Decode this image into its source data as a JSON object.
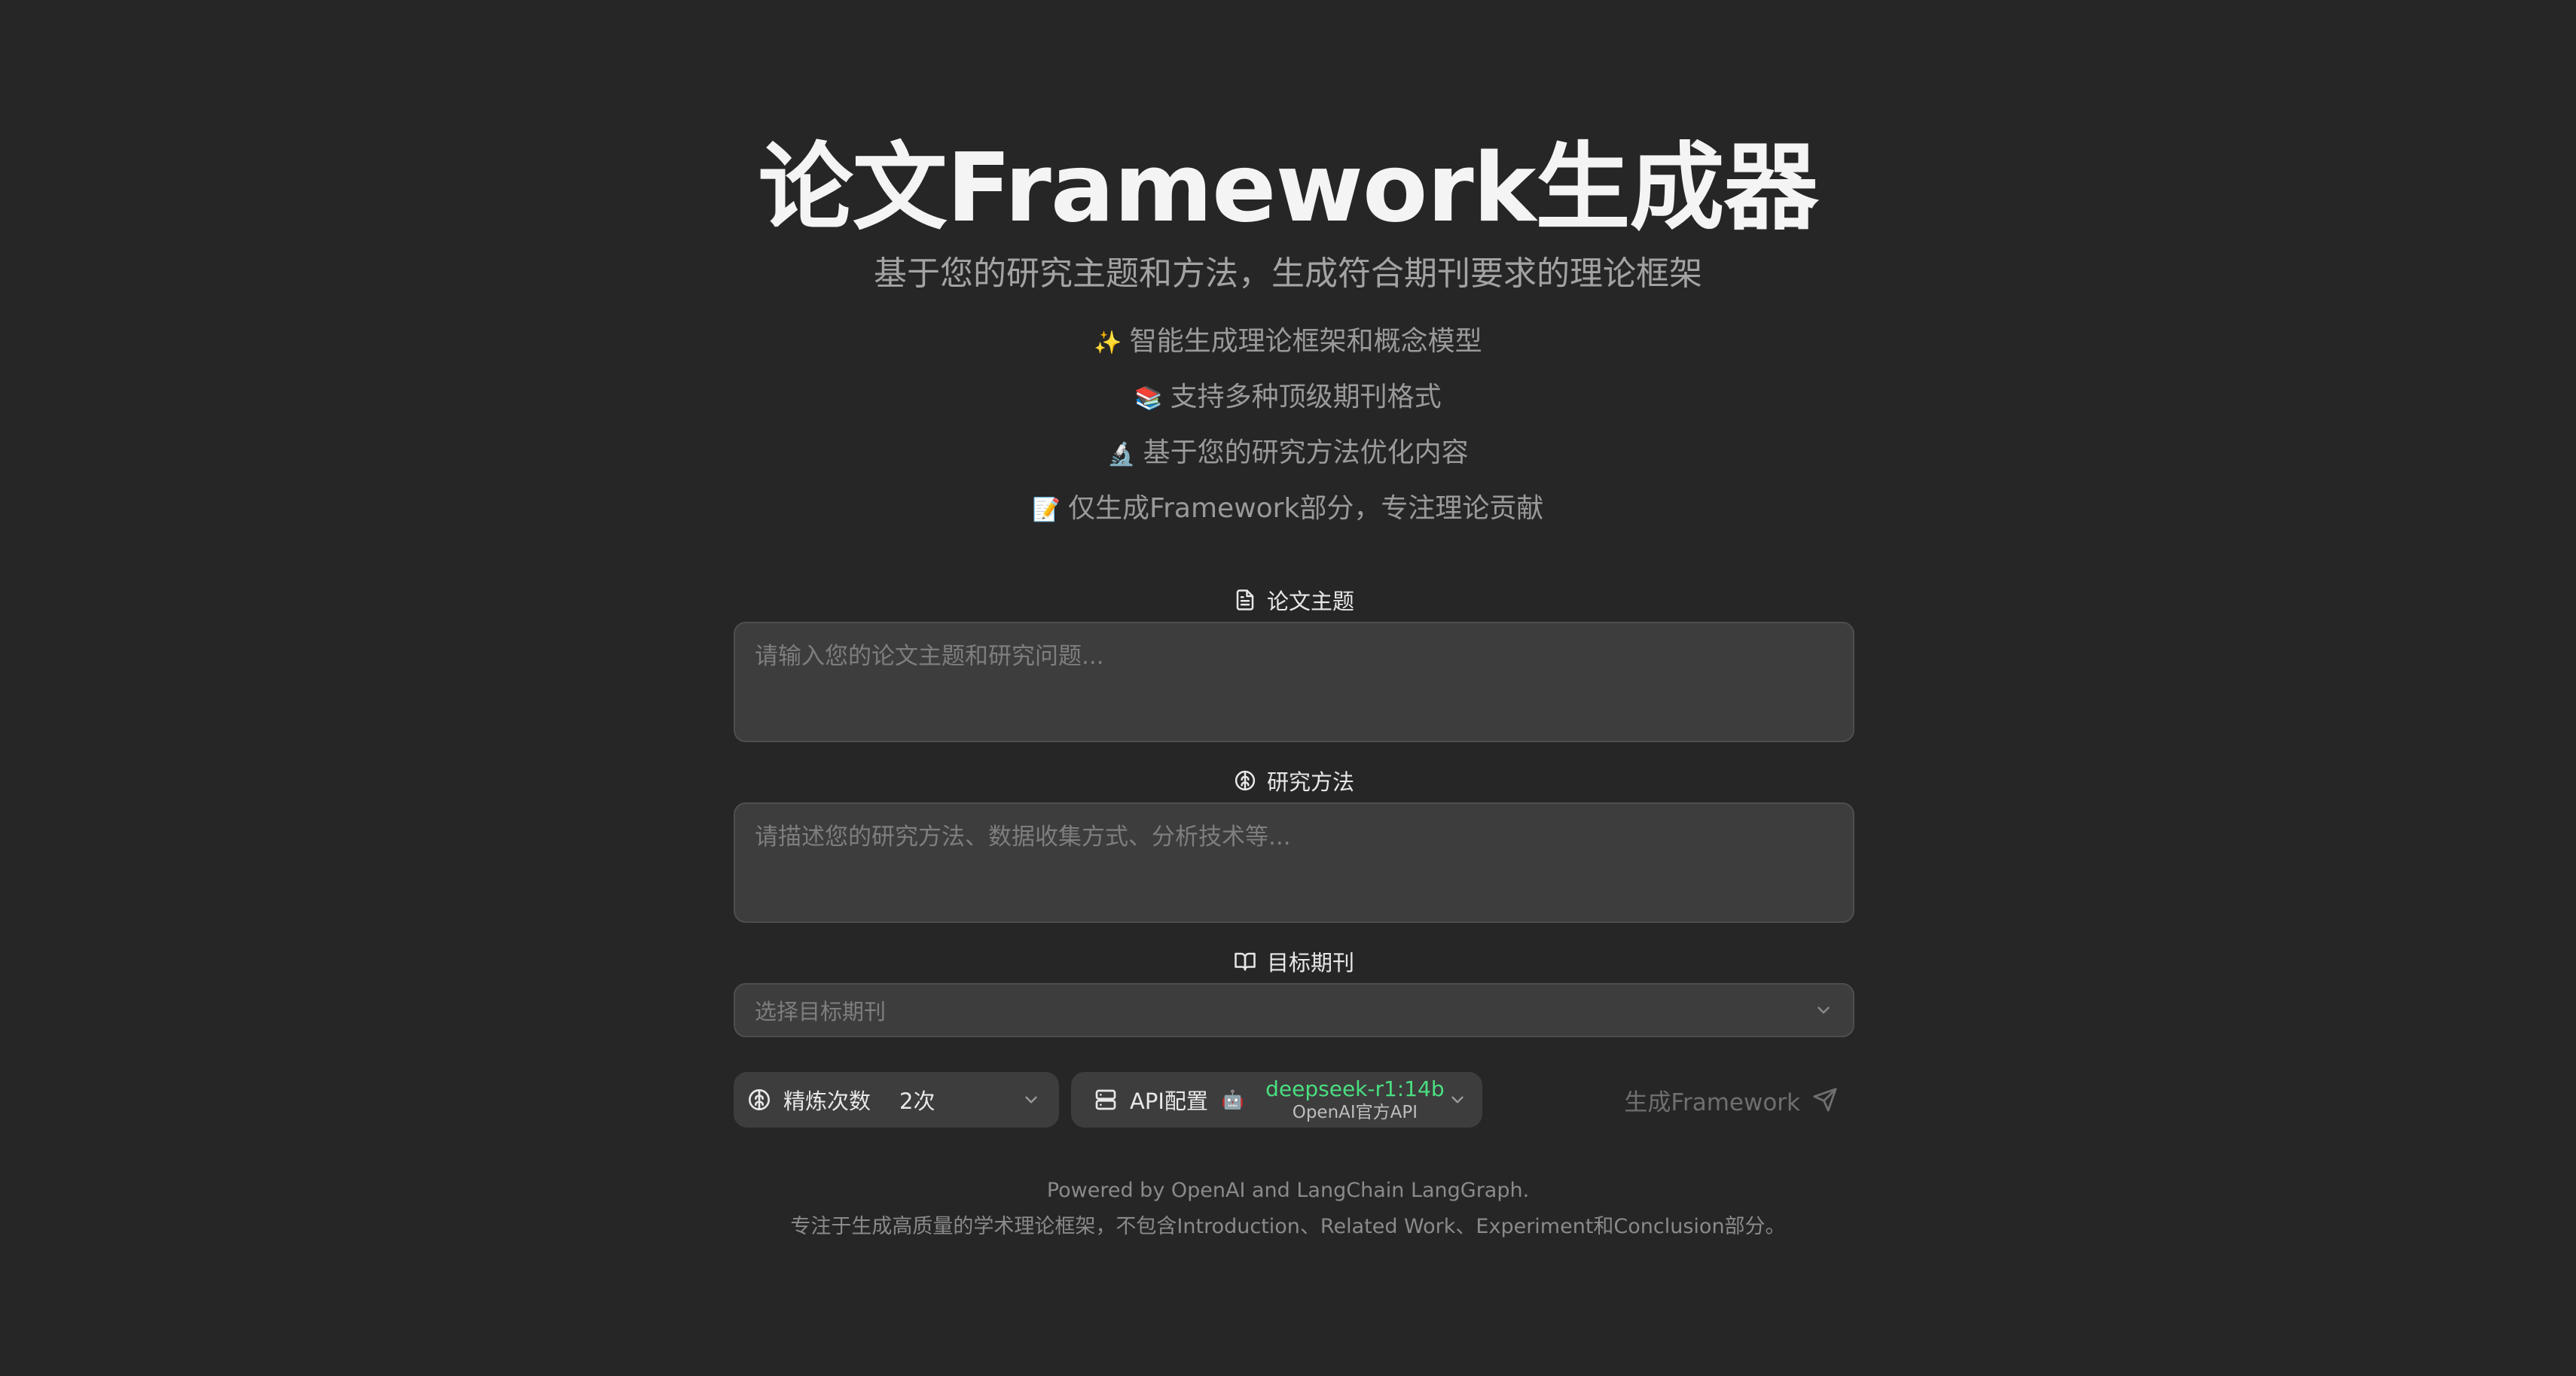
{
  "header": {
    "title": "论文Framework生成器",
    "subtitle": "基于您的研究主题和方法，生成符合期刊要求的理论框架",
    "features": [
      {
        "icon": "sparkles",
        "emoji": "✨",
        "text": "智能生成理论框架和概念模型"
      },
      {
        "icon": "books",
        "emoji": "📚",
        "text": "支持多种顶级期刊格式"
      },
      {
        "icon": "microscope",
        "emoji": "🔬",
        "text": "基于您的研究方法优化内容"
      },
      {
        "icon": "memo",
        "emoji": "📝",
        "text": "仅生成Framework部分，专注理论贡献"
      }
    ]
  },
  "form": {
    "topic": {
      "label": "论文主题",
      "icon": "file-text-icon",
      "placeholder": "请输入您的论文主题和研究问题...",
      "value": ""
    },
    "method": {
      "label": "研究方法",
      "icon": "brain-icon",
      "placeholder": "请描述您的研究方法、数据收集方式、分析技术等...",
      "value": ""
    },
    "journal": {
      "label": "目标期刊",
      "icon": "book-open-icon",
      "placeholder": "选择目标期刊"
    }
  },
  "controls": {
    "iterations": {
      "label": "精炼次数",
      "value": "2次"
    },
    "api": {
      "label": "API配置",
      "model": "deepseek-r1:14b",
      "provider": "OpenAI官方API",
      "model_emoji": "🤖"
    },
    "generate_label": "生成Framework"
  },
  "footer": {
    "line1": "Powered by OpenAI and LangChain LangGraph.",
    "line2": "专注于生成高质量的学术理论框架，不包含Introduction、Related Work、Experiment和Conclusion部分。"
  },
  "colors": {
    "background": "#262626",
    "input_bg": "#3d3d3d",
    "model_accent": "#4ade80"
  }
}
